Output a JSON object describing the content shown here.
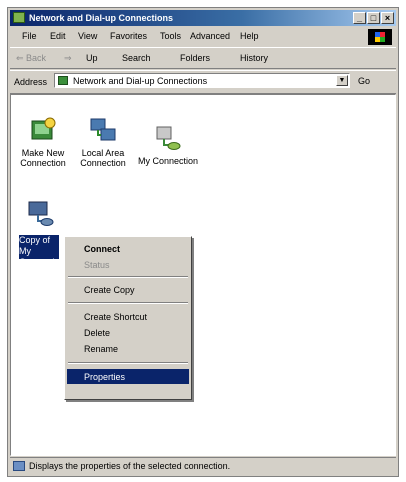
{
  "window": {
    "title": "Network and Dial-up Connections",
    "controls": {
      "minimize": "_",
      "maximize": "□",
      "close": "×"
    }
  },
  "menubar": {
    "items": [
      "File",
      "Edit",
      "View",
      "Favorites",
      "Tools",
      "Advanced",
      "Help"
    ]
  },
  "toolbar": {
    "back": "⇐ Back",
    "forward": "⇒",
    "up": "Up",
    "search": "Search",
    "folders": "Folders",
    "history": "History"
  },
  "address": {
    "label": "Address",
    "value": "Network and Dial-up Connections",
    "go": "Go"
  },
  "icons": [
    {
      "label_line1": "Make New",
      "label_line2": "Connection",
      "icon": "make-new-connection-icon"
    },
    {
      "label_line1": "Local Area",
      "label_line2": "Connection",
      "icon": "lan-connection-icon"
    },
    {
      "label_line1": "My Connection",
      "label_line2": "",
      "icon": "dialup-connection-icon"
    }
  ],
  "selected_item": {
    "label": "Copy of My Connection",
    "icon": "dialup-connection-icon"
  },
  "context_menu": {
    "items": [
      {
        "label": "Connect",
        "style": "default"
      },
      {
        "label": "Status",
        "style": "disabled"
      },
      {
        "label": "Create Copy",
        "style": "normal"
      },
      {
        "label": "Create Shortcut",
        "style": "normal"
      },
      {
        "label": "Delete",
        "style": "normal"
      },
      {
        "label": "Rename",
        "style": "normal"
      },
      {
        "label": "Properties",
        "style": "highlighted"
      }
    ]
  },
  "status_bar": {
    "text": "Displays the properties of the selected connection."
  },
  "colors": {
    "title_bar": "#0a246a",
    "selection": "#0a246a",
    "chrome": "#d4d0c8"
  }
}
